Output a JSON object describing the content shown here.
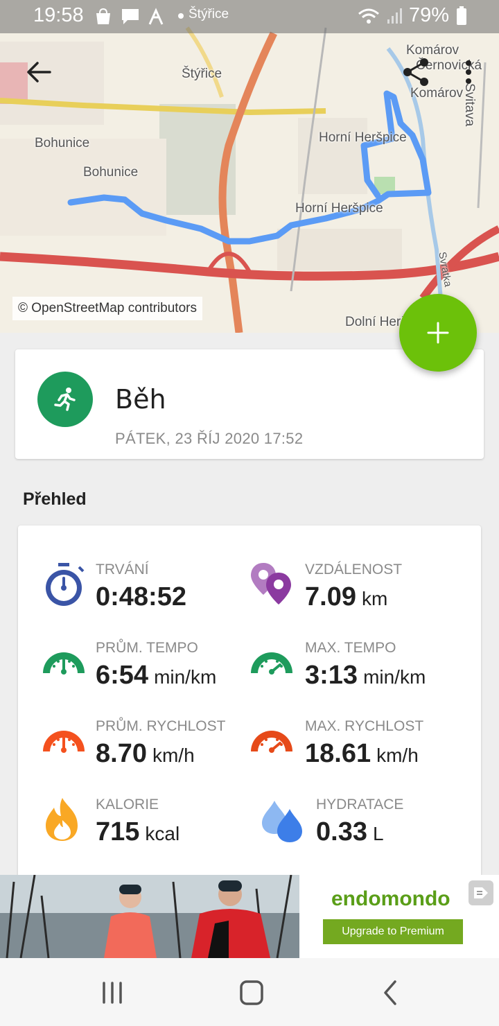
{
  "status_bar": {
    "time": "19:58",
    "notification_text": "Štýřice",
    "battery": "79%",
    "icons": [
      "shopping-bag-icon",
      "chat-icon",
      "strava-icon",
      "dot-icon",
      "wifi-icon",
      "signal-icon",
      "battery-icon"
    ]
  },
  "map": {
    "labels": [
      "Štýřice",
      "Komárov",
      "Černovická",
      "Komárov",
      "Bohunice",
      "Bohunice",
      "Horní Heršpice",
      "Horní Heršpice",
      "Svitava",
      "Dolní Heršpice",
      "Svratka"
    ],
    "attribution": "© OpenStreetMap contributors",
    "route_color": "#5b9bf5"
  },
  "toolbar": {
    "back_icon": "arrow-back-icon",
    "share_icon": "share-icon",
    "more_icon": "more-vertical-icon"
  },
  "fab": {
    "icon": "plus-icon",
    "color": "#6cc10a"
  },
  "activity": {
    "sport": "Běh",
    "date": "PÁTEK, 23 ŘÍJ 2020 17:52",
    "icon": "running-icon",
    "color": "#1e9b5c"
  },
  "overview": {
    "title": "Přehled",
    "stats": [
      {
        "label": "TRVÁNÍ",
        "value": "0:48:52",
        "unit": "",
        "icon": "stopwatch-icon",
        "color": "#3a54a6"
      },
      {
        "label": "VZDÁLENOST",
        "value": "7.09",
        "unit": "km",
        "icon": "location-pins-icon",
        "color": "#8b3aa0"
      },
      {
        "label": "PRŮM. TEMPO",
        "value": "6:54",
        "unit": "min/km",
        "icon": "pace-gauge-icon",
        "color": "#1e9b5c"
      },
      {
        "label": "MAX. TEMPO",
        "value": "3:13",
        "unit": "min/km",
        "icon": "max-pace-gauge-icon",
        "color": "#1e9b5c"
      },
      {
        "label": "PRŮM. RYCHLOST",
        "value": "8.70",
        "unit": "km/h",
        "icon": "speed-gauge-icon",
        "color": "#f4511e"
      },
      {
        "label": "MAX. RYCHLOST",
        "value": "18.61",
        "unit": "km/h",
        "icon": "max-speed-gauge-icon",
        "color": "#e64a19"
      },
      {
        "label": "KALORIE",
        "value": "715",
        "unit": "kcal",
        "icon": "flame-icon",
        "color": "#f9a825"
      },
      {
        "label": "HYDRATACE",
        "value": "0.33",
        "unit": "L",
        "icon": "water-drops-icon",
        "color": "#3d7ee8"
      }
    ]
  },
  "ad": {
    "brand": "endomondo",
    "cta": "Upgrade to Premium",
    "close_icon": "ad-close-icon"
  },
  "navbar": {
    "icons": [
      "recent-apps-icon",
      "home-icon",
      "back-nav-icon"
    ]
  }
}
